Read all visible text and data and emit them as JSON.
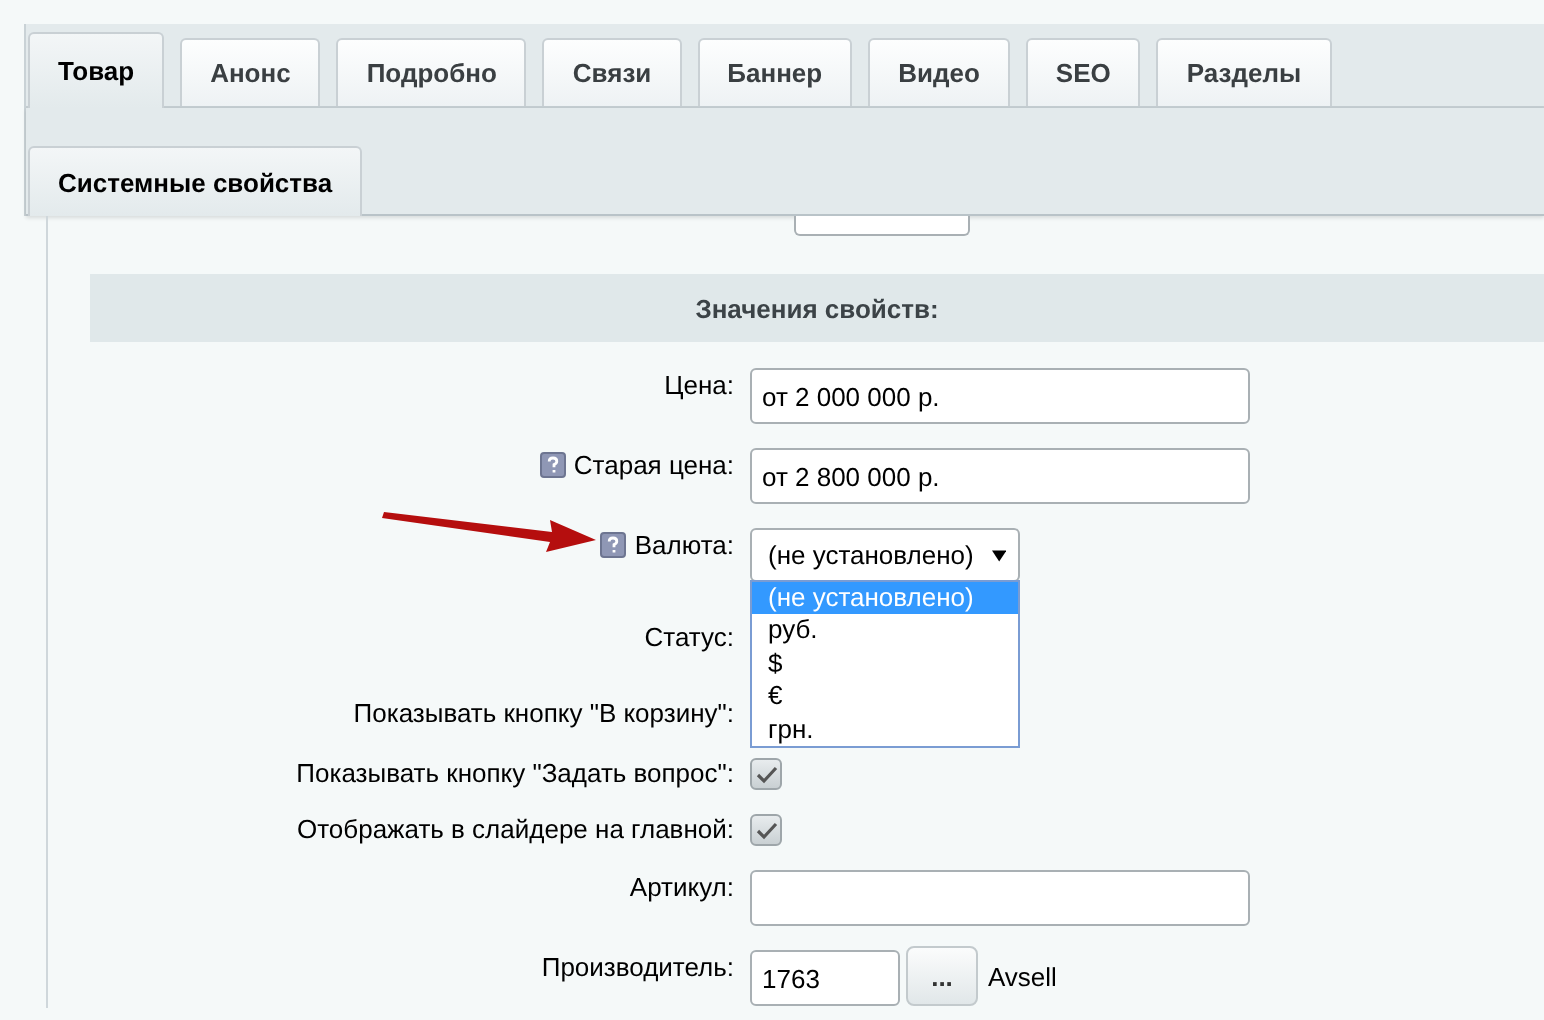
{
  "tabs": [
    {
      "label": "Товар",
      "selected": true
    },
    {
      "label": "Анонс",
      "selected": false
    },
    {
      "label": "Подробно",
      "selected": false
    },
    {
      "label": "Связи",
      "selected": false
    },
    {
      "label": "Баннер",
      "selected": false
    },
    {
      "label": "Видео",
      "selected": false
    },
    {
      "label": "SEO",
      "selected": false
    },
    {
      "label": "Разделы",
      "selected": false
    }
  ],
  "subtabs": [
    {
      "label": "Системные свойства",
      "selected": true
    }
  ],
  "section_title": "Значения свойств:",
  "fields": [
    {
      "kind": "text",
      "label": "Цена:",
      "value": "от 2 000 000 р.",
      "help": false
    },
    {
      "kind": "text",
      "label": "Старая цена:",
      "value": "от 2 800 000 р.",
      "help": true
    },
    {
      "kind": "select",
      "label": "Валюта:",
      "value": "(не установлено)",
      "help": true,
      "expanded": true,
      "options": [
        {
          "label": "(не установлено)",
          "selected": true
        },
        {
          "label": "руб.",
          "selected": false
        },
        {
          "label": "$",
          "selected": false
        },
        {
          "label": "€",
          "selected": false
        },
        {
          "label": "грн.",
          "selected": false
        }
      ]
    },
    {
      "kind": "covered",
      "label": "Статус:",
      "help": false
    },
    {
      "kind": "covered",
      "label": "Показывать кнопку \"В корзину\":",
      "help": false
    },
    {
      "kind": "checkbox",
      "label": "Показывать кнопку \"Задать вопрос\":",
      "checked": true,
      "help": false
    },
    {
      "kind": "checkbox",
      "label": "Отображать в слайдере на главной:",
      "checked": true,
      "help": false
    },
    {
      "kind": "text",
      "label": "Артикул:",
      "help": false
    },
    {
      "kind": "link",
      "label": "Производитель:",
      "value": "1763",
      "button": "...",
      "link_text": "Avsell",
      "help": false
    }
  ]
}
